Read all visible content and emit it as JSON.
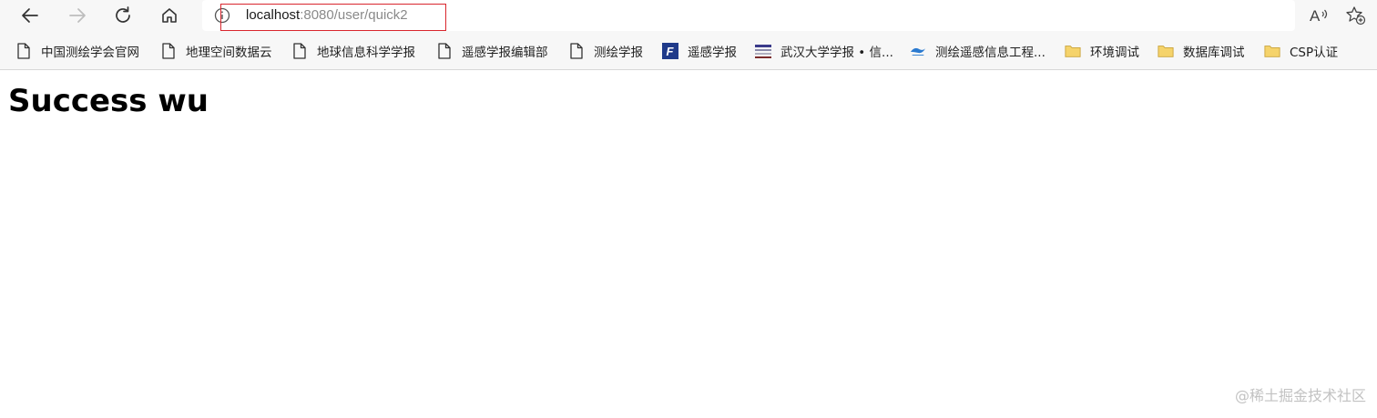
{
  "address_bar": {
    "host": "localhost",
    "path": ":8080/user/quick2"
  },
  "toolbar_icons": {
    "back": "back-arrow-icon",
    "forward": "forward-arrow-icon",
    "refresh": "refresh-icon",
    "home": "home-icon",
    "info": "info-icon",
    "read_aloud": "read-aloud-icon",
    "favorite": "add-favorite-icon"
  },
  "read_aloud_glyph": "A",
  "bookmarks": [
    {
      "label": "中国测绘学会官网",
      "icon": "page-icon"
    },
    {
      "label": "地理空间数据云",
      "icon": "page-icon"
    },
    {
      "label": "地球信息科学学报",
      "icon": "page-icon"
    },
    {
      "label": "遥感学报编辑部",
      "icon": "page-icon"
    },
    {
      "label": "测绘学报",
      "icon": "page-icon"
    },
    {
      "label": "遥感学报",
      "icon": "site-f-icon",
      "glyph": "F"
    },
    {
      "label": "武汉大学学报 • 信...",
      "icon": "site-whu-icon"
    },
    {
      "label": "测绘遥感信息工程...",
      "icon": "site-liesmars-icon"
    },
    {
      "label": "环境调试",
      "icon": "folder-icon"
    },
    {
      "label": "数据库调试",
      "icon": "folder-icon"
    },
    {
      "label": "CSP认证",
      "icon": "folder-icon"
    }
  ],
  "colors": {
    "highlight": "#d9262d",
    "folder": "#f5d36b",
    "site_f": "#1f3a8a"
  },
  "page": {
    "heading": "Success wu"
  },
  "watermark": "@稀土掘金技术社区"
}
